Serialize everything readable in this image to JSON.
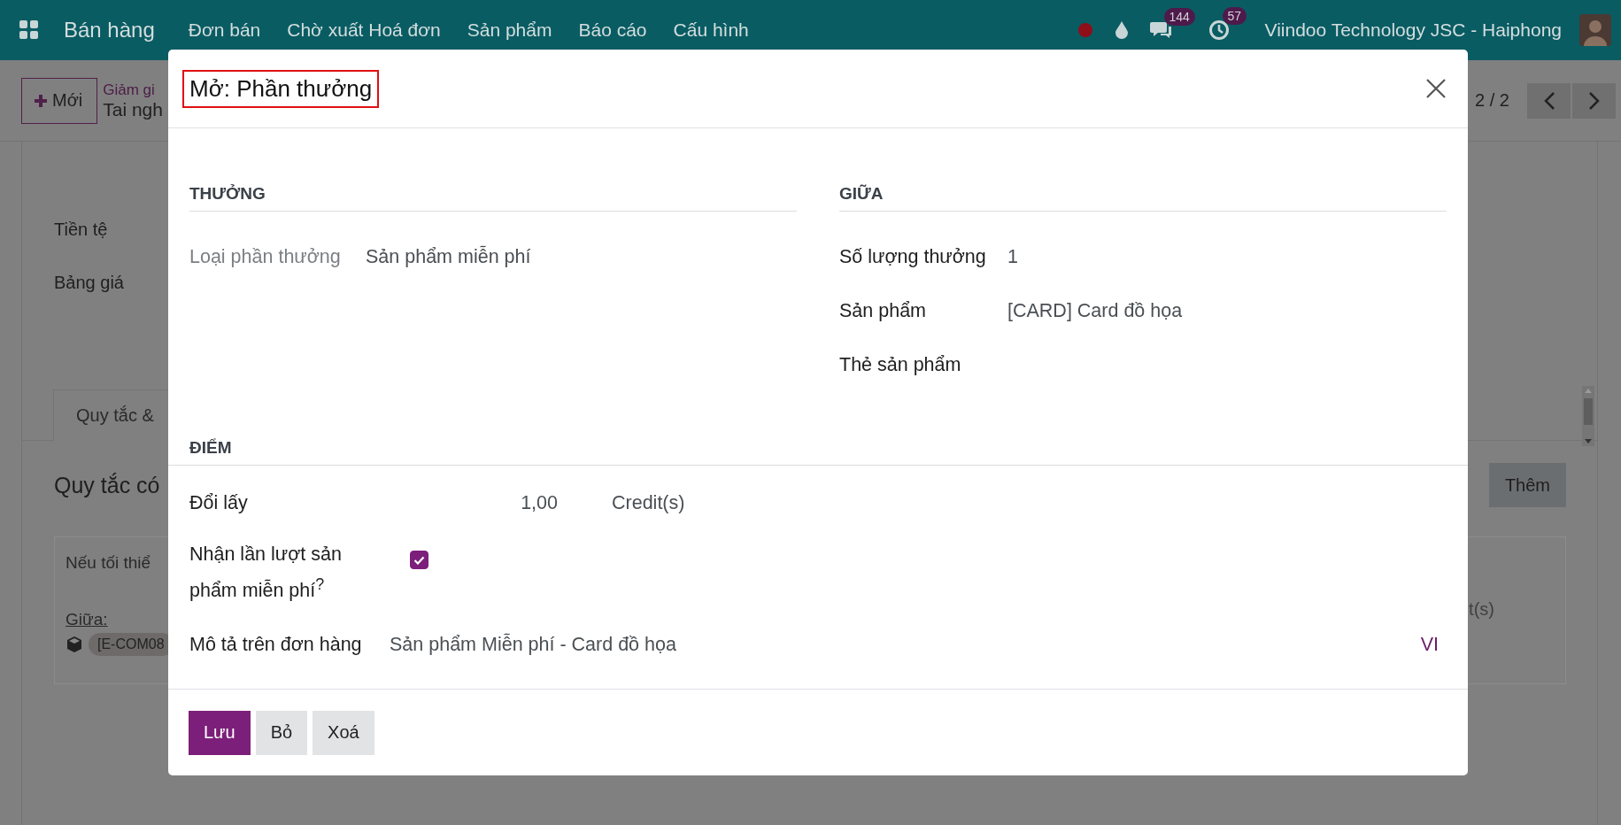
{
  "navbar": {
    "app_name": "Bán hàng",
    "menu": [
      "Đơn bán",
      "Chờ xuất Hoá đơn",
      "Sản phẩm",
      "Báo cáo",
      "Cấu hình"
    ],
    "messages_badge": "144",
    "activities_badge": "57",
    "company": "Viindoo Technology JSC - Haiphong"
  },
  "control_panel": {
    "new_button": "Mới",
    "breadcrumb": "Giảm gi",
    "record_title": "Tai ngh",
    "pager": "2 / 2"
  },
  "background_form": {
    "fields": [
      "Tiền tệ",
      "Bảng giá"
    ],
    "tab": "Quy tắc & ",
    "section_title": "Quy tắc có",
    "add_button": "Thêm",
    "card": {
      "line_1": "Nếu tối thiể",
      "among_label": "Giữa:",
      "product_tag": "[E-COM08",
      "right_text": "t(s)"
    }
  },
  "dialog": {
    "title": "Mở: Phần thưởng",
    "title_highlighted": true,
    "sections": [
      {
        "heading": "THƯỞNG",
        "fields": [
          {
            "label": "Loại phần thưởng",
            "value": "Sản phẩm miễn phí",
            "kind": "readonly"
          }
        ]
      },
      {
        "heading": "GIỮA",
        "fields": [
          {
            "label": "Số lượng thưởng",
            "value": "1",
            "kind": "normal"
          },
          {
            "label": "Sản phẩm",
            "value": "[CARD] Card đồ họa",
            "kind": "normal"
          },
          {
            "label": "Thẻ sản phẩm",
            "kind": "normal"
          }
        ]
      }
    ],
    "points": {
      "heading": "ĐIỂM",
      "cost_label": "Đổi lấy",
      "cost_value": "1,00",
      "cost_unit": "Credit(s)",
      "toggle_label": "Nhận lần lượt sản phẩm miễn phí$^{?}$",
      "toggle_checked": true,
      "description_label": "Mô tả trên đơn hàng",
      "description_value": "Sản phẩm Miễn phí - Card đồ họa",
      "language": "VI"
    },
    "buttons": [
      {
        "label": "Lưu",
        "kind": "primary"
      },
      {
        "label": "Bỏ",
        "kind": "secondary"
      },
      {
        "label": "Xoá",
        "kind": "secondary"
      }
    ]
  }
}
